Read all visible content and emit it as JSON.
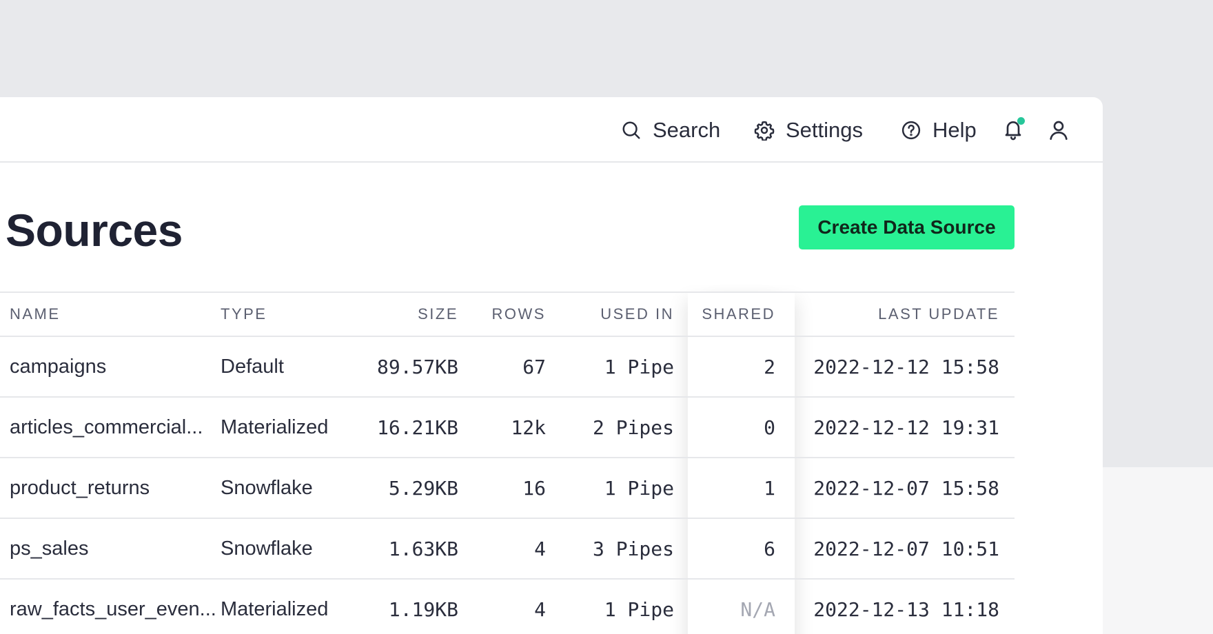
{
  "nav": {
    "search_label": "Search",
    "settings_label": "Settings",
    "help_label": "Help",
    "notification_dot_color": "#27c79a"
  },
  "page": {
    "title": "Sources",
    "create_button_label": "Create Data Source",
    "accent_color": "#29f194"
  },
  "table": {
    "columns": {
      "name": "NAME",
      "type": "TYPE",
      "size": "SIZE",
      "rows": "ROWS",
      "used_in": "USED IN",
      "shared": "SHARED",
      "last_update": "LAST UPDATE"
    },
    "rows": [
      {
        "name": "campaigns",
        "type": "Default",
        "size": "89.57KB",
        "rows": "67",
        "used_in": "1 Pipe",
        "shared": "2",
        "last_update": "2022-12-12 15:58"
      },
      {
        "name": "articles_commercial...",
        "type": "Materialized",
        "size": "16.21KB",
        "rows": "12k",
        "used_in": "2 Pipes",
        "shared": "0",
        "last_update": "2022-12-12 19:31"
      },
      {
        "name": "product_returns",
        "type": "Snowflake",
        "size": "5.29KB",
        "rows": "16",
        "used_in": "1 Pipe",
        "shared": "1",
        "last_update": "2022-12-07 15:58"
      },
      {
        "name": "ps_sales",
        "type": "Snowflake",
        "size": "1.63KB",
        "rows": "4",
        "used_in": "3 Pipes",
        "shared": "6",
        "last_update": "2022-12-07 10:51"
      },
      {
        "name": "raw_facts_user_even...",
        "type": "Materialized",
        "size": "1.19KB",
        "rows": "4",
        "used_in": "1 Pipe",
        "shared": "N/A",
        "last_update": "2022-12-13 11:18"
      }
    ]
  }
}
